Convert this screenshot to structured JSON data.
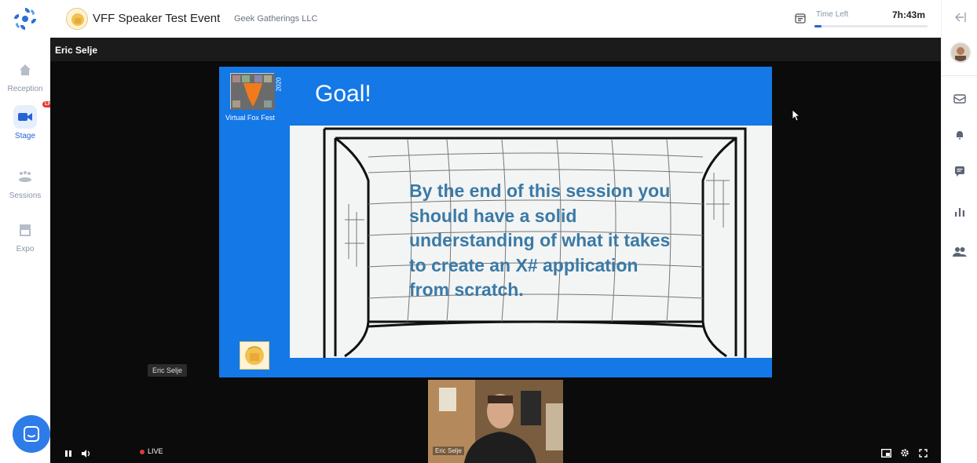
{
  "leftnav": {
    "items": [
      {
        "label": "Reception",
        "icon": "home-icon"
      },
      {
        "label": "Stage",
        "icon": "camera-icon",
        "badge": "LIVE"
      },
      {
        "label": "Sessions",
        "icon": "group-icon"
      },
      {
        "label": "Expo",
        "icon": "booth-icon"
      }
    ]
  },
  "header": {
    "event_title": "VFF Speaker Test Event",
    "organizer": "Geek Gatherings LLC",
    "time_left_label": "Time Left",
    "time_left_value": "7h:43m",
    "time_progress": 0.06
  },
  "stage": {
    "presenter_name": "Eric Selje",
    "speaker_tag": "Eric Selje",
    "camera_tag": "Eric Selje",
    "live_label": "LIVE"
  },
  "slide": {
    "title": "Goal!",
    "year": "2020",
    "brand": "Virtual Fox Fest",
    "body": "By the end of this session you should have a solid understanding of what it takes to create an X# application from scratch."
  },
  "colors": {
    "accent": "#2463d8",
    "slide_bg": "#1478e6",
    "slide_text": "#3a7aa6",
    "live": "#e53935"
  }
}
